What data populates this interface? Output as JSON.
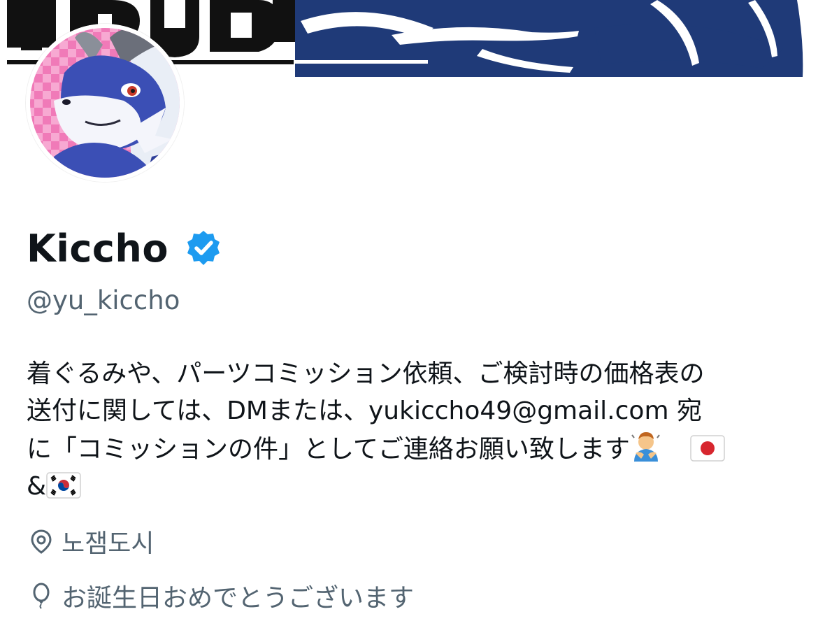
{
  "banner": {
    "title_text": "IBUKI",
    "colors": {
      "navy": "#1f3a78",
      "black": "#111111",
      "white": "#ffffff"
    }
  },
  "profile": {
    "display_name": "Kiccho",
    "handle": "@yu_kiccho",
    "verified": true,
    "verified_color": "#1d9bf0",
    "avatar_icon": "dragon-character-avatar"
  },
  "bio": {
    "line1": "着ぐるみや、パーツコミッション依頼、ご検討時の価格表の",
    "line2_before": "送付に関しては、DMまたは、",
    "email": "yukiccho49@gmail.com",
    "line2_after": " 宛",
    "line3": "に「コミッションの件」としてご連絡お願い致します",
    "line4": "&",
    "emojis": [
      "person-bowing",
      "flag-japan",
      "flag-south-korea"
    ]
  },
  "meta": {
    "location": "노잼도시",
    "location_icon": "location-pin-icon",
    "birthday": "お誕生日おめでとうございます",
    "birthday_icon": "balloon-icon"
  },
  "colors": {
    "text_primary": "#0f1419",
    "text_secondary": "#536471",
    "accent": "#1d9bf0"
  }
}
